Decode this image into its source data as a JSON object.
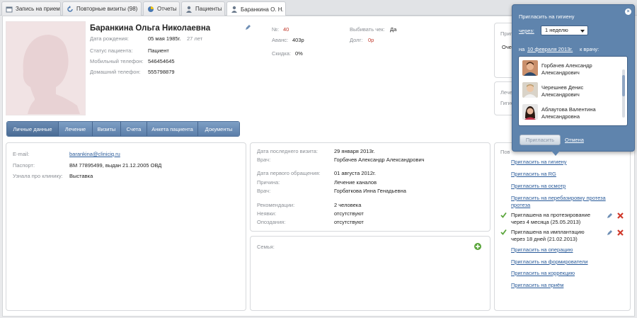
{
  "tabs": [
    {
      "label": "Запись на прием",
      "icon": "calendar-icon"
    },
    {
      "label": "Повторные визиты (98)",
      "icon": "refresh-icon"
    },
    {
      "label": "Отчеты",
      "icon": "pie-chart-icon"
    },
    {
      "label": "Пациенты",
      "icon": "user-icon"
    },
    {
      "label": "Баранкина О. Н.",
      "icon": "user-icon"
    }
  ],
  "patient": {
    "name": "Баранкина Ольга Николаевна",
    "birth_label": "Дата рождения:",
    "birth_value": "05 мая 1985г.",
    "age": "27 лет",
    "status_label": "Статус пациента:",
    "status_value": "Пациент",
    "mobile_label": "Мобильный телефон:",
    "mobile_value": "546454645",
    "home_label": "Домашний телефон:",
    "home_value": "555798879",
    "num_label": "№:",
    "num_value": "40",
    "avans_label": "Аванс:",
    "avans_value": "403р",
    "discount_label": "Скидка:",
    "discount_value": "0%",
    "check_label": "Выбивать чек:",
    "check_value": "Да",
    "debt_label": "Долг:",
    "debt_value": "0р"
  },
  "subtabs": [
    "Личные данные",
    "Лечение",
    "Визиты",
    "Счета",
    "Анкета пациента",
    "Документы"
  ],
  "personal": {
    "email_label": "E-mail:",
    "email_value": "barankina@cliniciq.ru",
    "passport_label": "Паспорт:",
    "passport_value": "ВМ 77895499, выдан 21.12.2005 ОВД",
    "source_label": "Узнала про клинику:",
    "source_value": "Выставка"
  },
  "visits": {
    "last_label": "Дата последнего визита:",
    "last_value": "29 января 2013г.",
    "doctor_label": "Врач:",
    "doctor_value": "Горбачев Александр Александрович",
    "first_label": "Дата первого обращения:",
    "first_value": "01 августа 2012г.",
    "reason_label": "Причина:",
    "reason_value": "Лечение каналов",
    "doctor2_label": "Врач:",
    "doctor2_value": "Горбаткова Инна Генадьевна",
    "rec_label": "Рекомендации:",
    "rec_value": "2 человека",
    "noshow_label": "Неявки:",
    "noshow_value": "отсутствуют",
    "late_label": "Опоздания:",
    "late_value": "отсутствуют"
  },
  "family": {
    "label": "Семья:"
  },
  "right_partial": {
    "a": "Пригл",
    "b": "Оче",
    "c": "Лече",
    "d": "Гигие",
    "e": "Пов"
  },
  "invites": {
    "links": [
      "Пригласить на гигиену",
      "Пригласить на RG",
      "Пригласить на осмотр",
      "Пригласить на перебазировку протеза"
    ],
    "invited": [
      {
        "line1": "Приглашена на протезирование",
        "line2": "через 4 месяца (25.05.2013)"
      },
      {
        "line1": "Приглашена на имплантацию",
        "line2": "через 18 дней (21.02.2013)"
      }
    ],
    "links2": [
      "Пригласить на операцию",
      "Пригласить на формирователи",
      "Пригласить на коррекцию",
      "Пригласить на приём"
    ]
  },
  "popup": {
    "title": "Пригласить на гигиену",
    "through_label": "через:",
    "through_value": "1 неделю",
    "on_label": "на",
    "date_value": "10 февраля 2013г.",
    "to_doctor": "к врачу:",
    "doctors": [
      {
        "name1": "Горбачев Александр",
        "name2": "Александрович"
      },
      {
        "name1": "Черешнев Денис",
        "name2": "Александрович"
      },
      {
        "name1": "Аблаутова Валентина",
        "name2": "Александровна"
      }
    ],
    "invite_button": "Пригласить",
    "cancel_link": "Отмена"
  },
  "colors": {
    "accent": "#5f84ad",
    "link": "#2a5b9a",
    "ok_green": "#5aa53b",
    "delete_red": "#d03a2c"
  }
}
